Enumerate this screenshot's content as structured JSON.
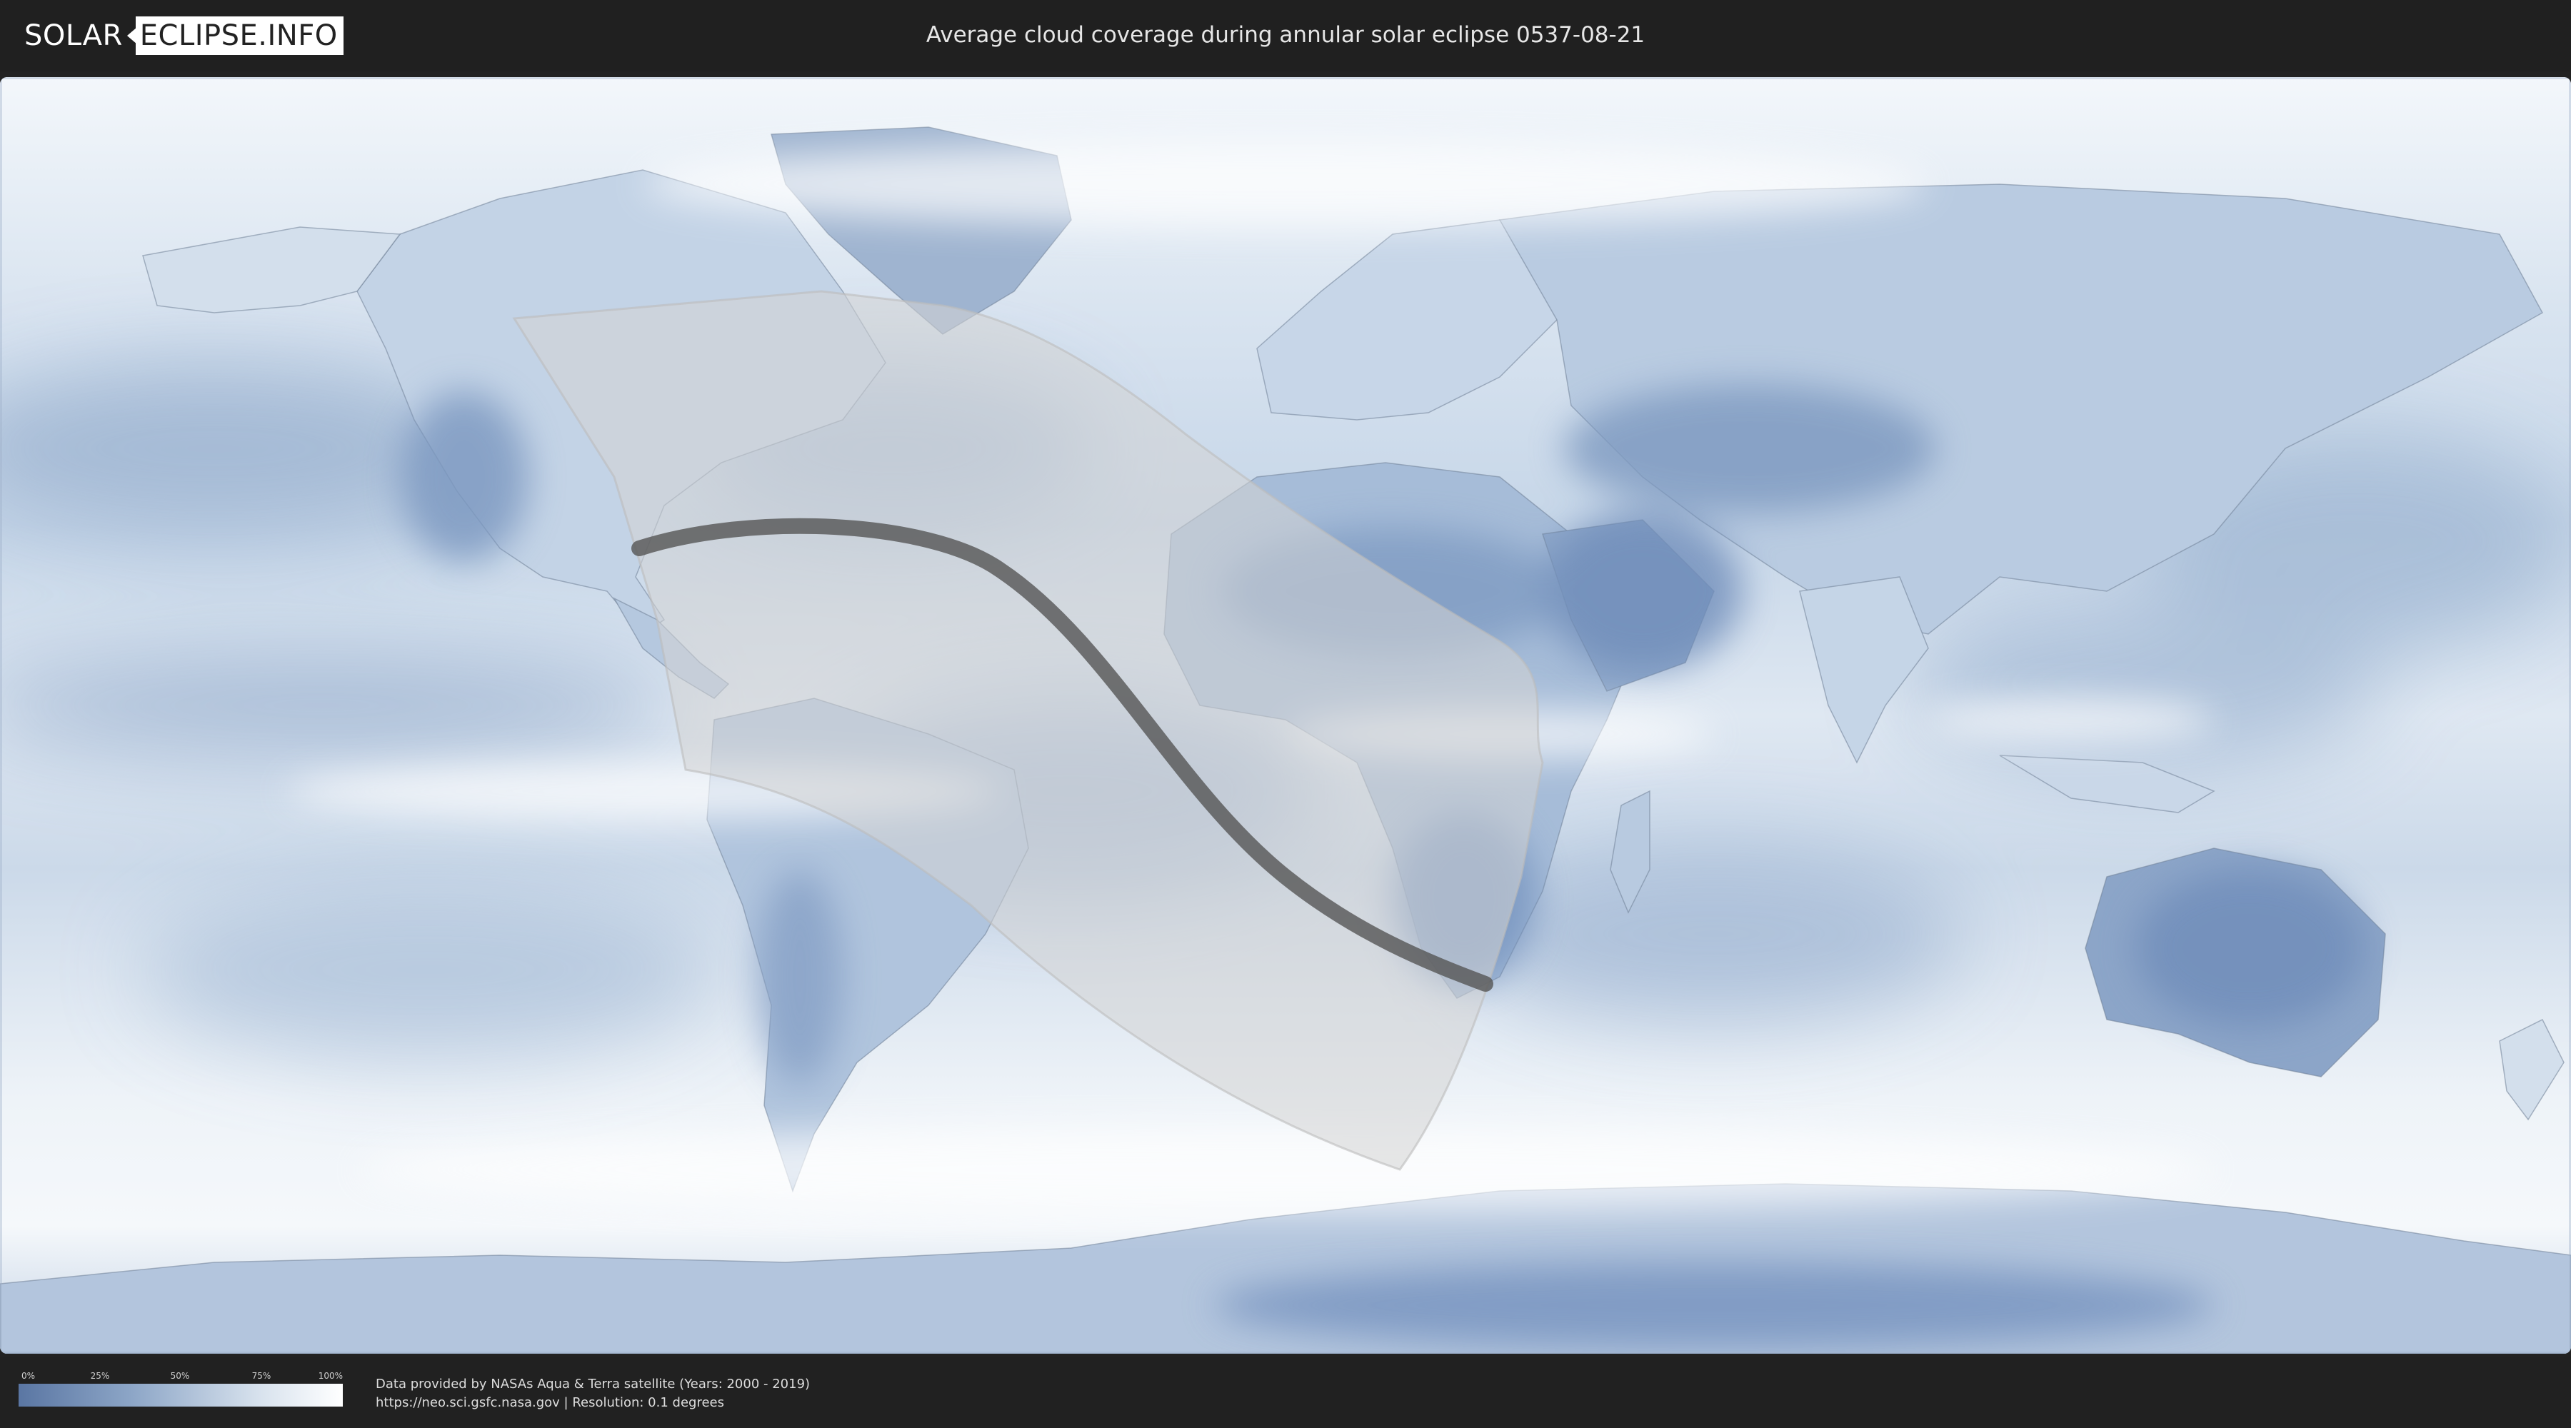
{
  "header": {
    "logo_left": "SOLAR",
    "logo_right": "ECLIPSE.INFO",
    "title": "Average cloud coverage during annular solar eclipse 0537-08-21"
  },
  "map": {
    "eclipse_type": "annular",
    "eclipse_date": "0537-08-21",
    "colors": {
      "ocean_clear": "#5a76a3",
      "cloud_full": "#ffffff",
      "penumbra_overlay": "#cfcfcf",
      "central_path": "#555555",
      "border_lines": "#6f7f95"
    }
  },
  "legend": {
    "ticks": [
      "0%",
      "25%",
      "50%",
      "75%",
      "100%"
    ],
    "gradient_start": "#5a76a3",
    "gradient_end": "#ffffff"
  },
  "credits": {
    "line1": "Data provided by NASAs Aqua & Terra satellite (Years: 2000 - 2019)",
    "line2": "https://neo.sci.gsfc.nasa.gov | Resolution: 0.1 degrees"
  }
}
